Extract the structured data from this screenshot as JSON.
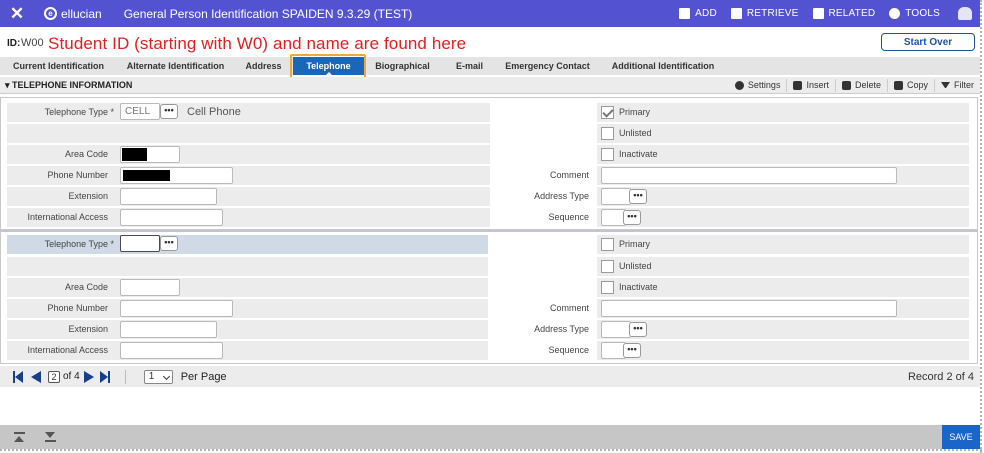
{
  "topbar": {
    "brand": "ellucian",
    "title": "General Person Identification SPAIDEN 9.3.29 (TEST)",
    "actions": [
      "ADD",
      "RETRIEVE",
      "RELATED",
      "TOOLS"
    ]
  },
  "idrow": {
    "id_label": "ID:",
    "id_value": "W00",
    "annotation": "Student ID (starting with W0) and name are found here",
    "start_over": "Start Over"
  },
  "tabs": [
    "Current Identification",
    "Alternate Identification",
    "Address",
    "Telephone",
    "Biographical",
    "E-mail",
    "Emergency Contact",
    "Additional Identification"
  ],
  "active_tab": "Telephone",
  "section": {
    "title": "TELEPHONE INFORMATION",
    "tools": [
      "Settings",
      "Insert",
      "Delete",
      "Copy",
      "Filter"
    ]
  },
  "labels": {
    "telephone_type": "Telephone Type *",
    "area_code": "Area Code",
    "phone_number": "Phone Number",
    "extension": "Extension",
    "international_access": "International Access",
    "primary": "Primary",
    "unlisted": "Unlisted",
    "inactivate": "Inactivate",
    "comment": "Comment",
    "address_type": "Address Type",
    "sequence": "Sequence",
    "ellipsis": "•••"
  },
  "records": [
    {
      "telephone_type": "CELL",
      "telephone_type_desc": "Cell Phone",
      "primary": true,
      "unlisted": false,
      "inactivate": false
    },
    {
      "telephone_type": "",
      "telephone_type_desc": "",
      "primary": false,
      "unlisted": false,
      "inactivate": false
    }
  ],
  "pager": {
    "current_page": "2",
    "of_text": "of 4",
    "per_page_value": "1",
    "per_page_label": "Per Page",
    "record_count": "Record 2 of 4"
  },
  "bottombar": {
    "save": "SAVE"
  },
  "colors": {
    "topbar": "#5353d1",
    "active_tab": "#1a66b8",
    "highlight": "#f2a73b",
    "annotation": "#e02020",
    "save": "#1a66c8"
  }
}
